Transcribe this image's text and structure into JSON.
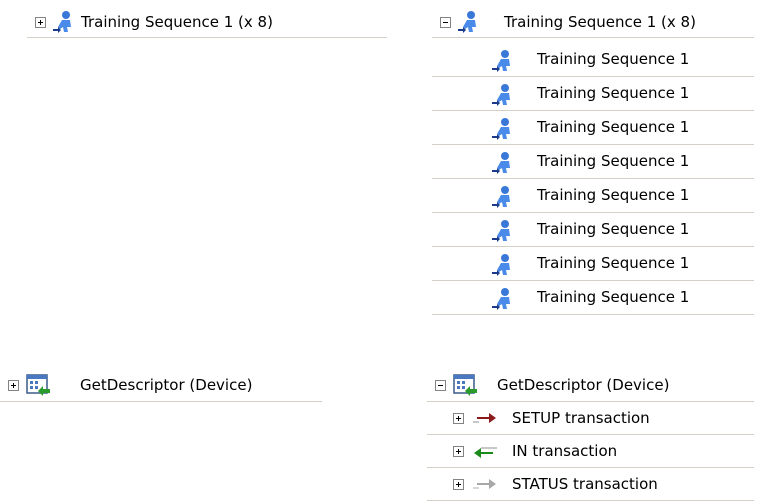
{
  "colors": {
    "separator": "#d4d0c8",
    "setup_arrow": "#8b1a1a",
    "in_arrow": "#1a8a1a",
    "status_arrow": "#a8a8a8"
  },
  "icons": {
    "training": "person-icon",
    "descriptor": "descriptor-window-icon",
    "setup": "arrow-right-icon",
    "in": "arrow-left-icon",
    "status": "arrow-right-gray-icon"
  },
  "left_top": {
    "label": "Training Sequence 1 (x 8)",
    "expander": "+"
  },
  "right_top": {
    "label": "Training Sequence 1 (x 8)",
    "expander": "-",
    "children": [
      "Training Sequence 1",
      "Training Sequence 1",
      "Training Sequence 1",
      "Training Sequence 1",
      "Training Sequence 1",
      "Training Sequence 1",
      "Training Sequence 1",
      "Training Sequence 1"
    ]
  },
  "left_bottom": {
    "label": "GetDescriptor (Device)",
    "expander": "+"
  },
  "right_bottom": {
    "label": "GetDescriptor (Device)",
    "expander": "-",
    "children": [
      "SETUP transaction",
      "IN transaction",
      "STATUS transaction"
    ]
  }
}
